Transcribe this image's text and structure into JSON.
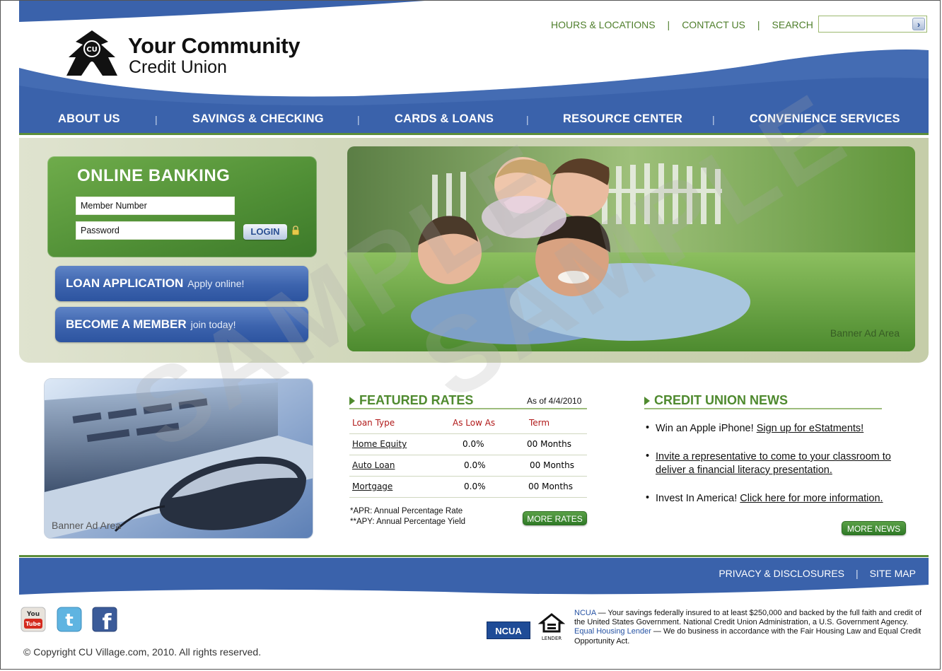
{
  "brand": {
    "line1": "Your Community",
    "line2": "Credit Union"
  },
  "utility_nav": {
    "items": [
      "HOURS & LOCATIONS",
      "CONTACT US",
      "SEARCH"
    ],
    "separator": "|",
    "search_go": "›"
  },
  "main_nav": {
    "items": [
      "ABOUT US",
      "SAVINGS & CHECKING",
      "CARDS & LOANS",
      "RESOURCE CENTER",
      "CONVENIENCE SERVICES"
    ],
    "separator": "|"
  },
  "online_banking": {
    "title": "ONLINE BANKING",
    "member_field": "Member Number",
    "password_field": "Password",
    "login_label": "LOGIN"
  },
  "promos": [
    {
      "title": "LOAN APPLICATION",
      "sub": "Apply online!"
    },
    {
      "title": "BECOME A MEMBER",
      "sub": "join today!"
    }
  ],
  "banners": {
    "hero_label": "Banner Ad Area",
    "side_label": "Banner Ad Area"
  },
  "featured_rates": {
    "title": "FEATURED RATES",
    "as_of": "As of 4/4/2010",
    "headers": [
      "Loan Type",
      "As Low As",
      "Term"
    ],
    "rows": [
      [
        "Home Equity",
        "0.0%",
        "00 Months"
      ],
      [
        "Auto Loan",
        "0.0%",
        "00 Months"
      ],
      [
        "Mortgage",
        "0.0%",
        "00 Months"
      ]
    ],
    "footnote1": "*APR: Annual Percentage Rate",
    "footnote2": "**APY: Annual Percentage Yield",
    "more_label": "MORE RATES"
  },
  "news": {
    "title": "CREDIT UNION NEWS",
    "bullet": "•",
    "items": [
      {
        "text": "Win an Apple iPhone! ",
        "link": "Sign up for eStatments!"
      },
      {
        "text": "",
        "link": "Invite a representative to come to your classroom to deliver a financial literacy presentation."
      },
      {
        "text": "Invest In America! ",
        "link": "Click here for more information."
      }
    ],
    "more_label": "MORE NEWS"
  },
  "footer": {
    "links": [
      "PRIVACY & DISCLOSURES",
      "SITE MAP"
    ],
    "separator": "|",
    "copyright": "© Copyright CU Village.com, 2010. All rights reserved.",
    "ncua_badge": "NCUA",
    "ehl_caption": "LENDER",
    "disclaimer_ncua": "NCUA",
    "disclaimer_1": " — Your savings federally insured to at least $250,000 and backed by the full faith and credit of the United States Government. National Credit Union Administration, a U.S. Government Agency. ",
    "disclaimer_ehl": "Equal Housing Lender",
    "disclaimer_2": " — We do business in accordance with the Fair Housing Law and Equal Credit Opportunity Act."
  },
  "watermark": "SAMPLE",
  "colors": {
    "nav_blue": "#3a62ab",
    "accent_green": "#4f8a2f",
    "rate_header_red": "#b11a1a"
  }
}
